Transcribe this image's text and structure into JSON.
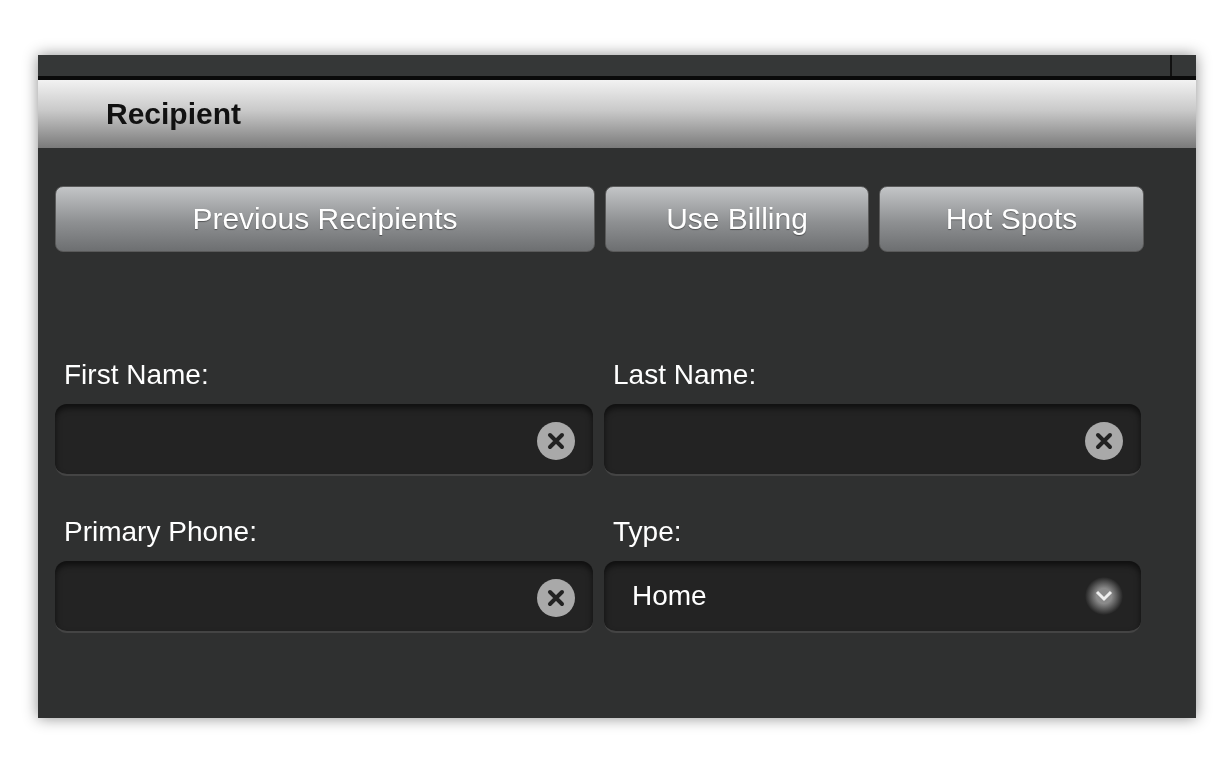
{
  "section": {
    "title": "Recipient"
  },
  "buttons": [
    "Previous Recipients",
    "Use Billing",
    "Hot Spots"
  ],
  "fields": [
    {
      "kind": "text",
      "label": "First Name:"
    },
    {
      "kind": "text",
      "label": "Last Name:"
    },
    {
      "kind": "text",
      "label": "Primary Phone:"
    },
    {
      "kind": "select",
      "label": "Type:",
      "value": "Home"
    }
  ]
}
